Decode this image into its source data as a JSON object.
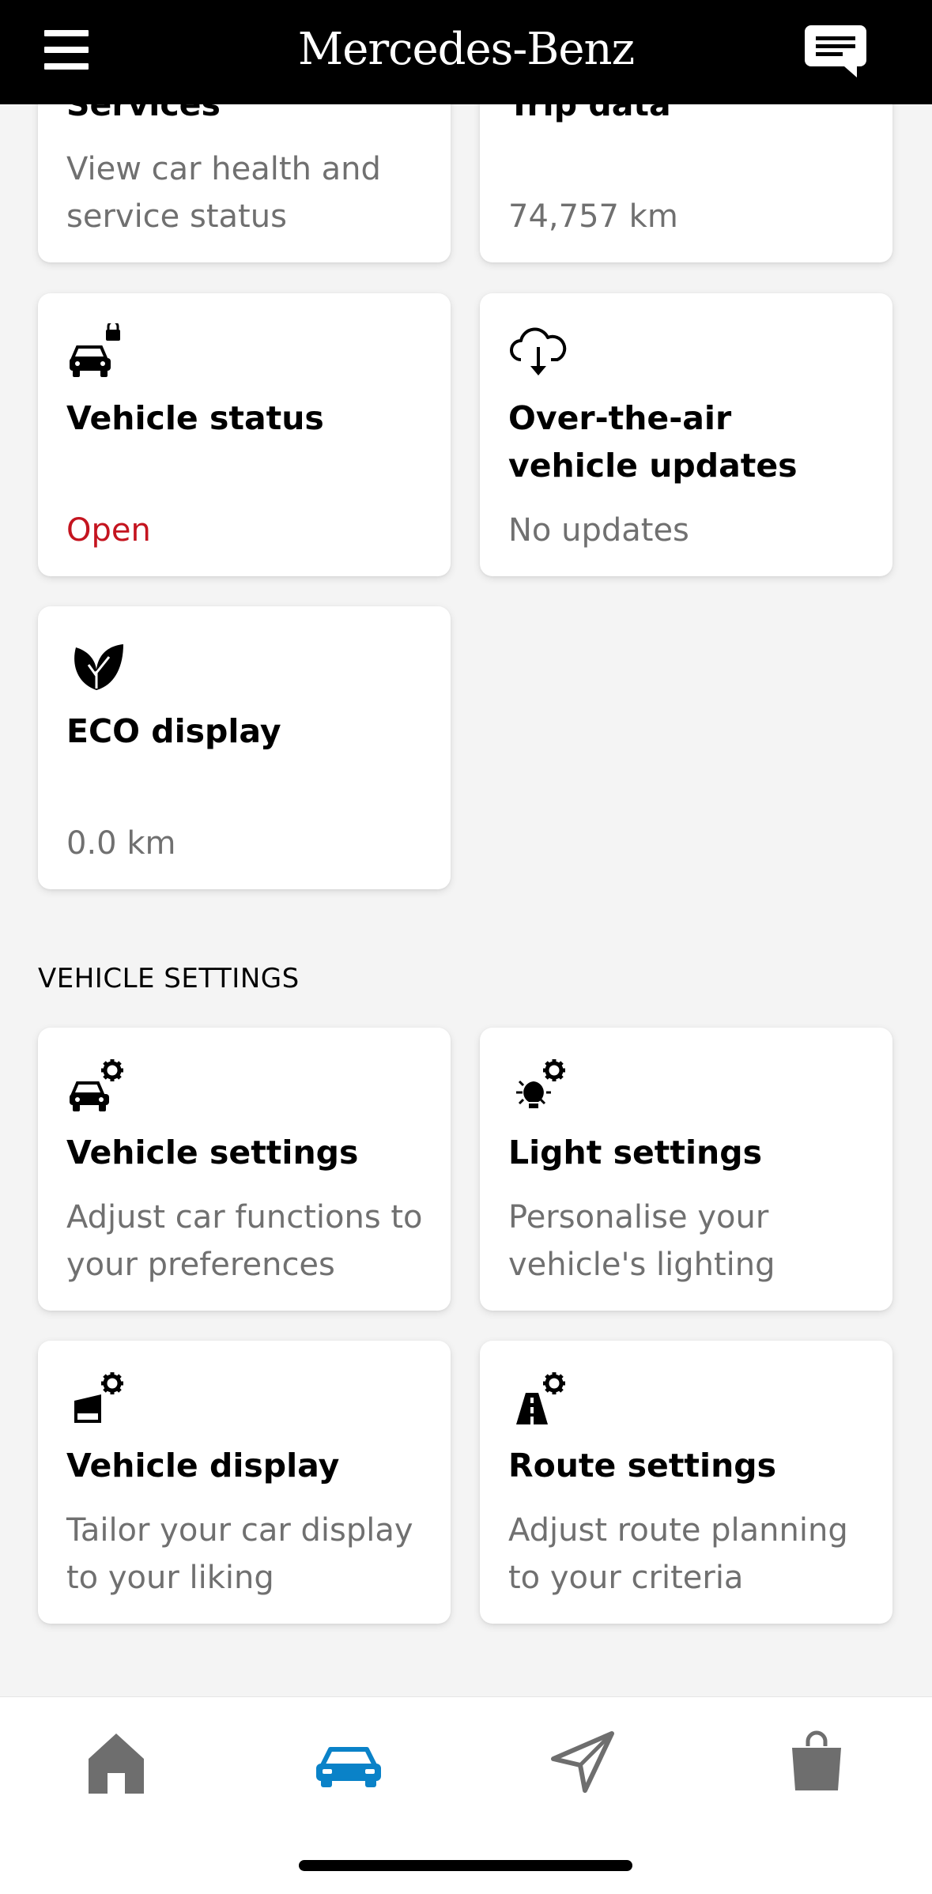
{
  "header": {
    "brand": "Mercedes-Benz",
    "menu_icon": "hamburger-menu-icon",
    "chat_icon": "chat-bubble-icon",
    "background": "#000000"
  },
  "cards_top": [
    {
      "title": "Services",
      "subtitle": "View car health and service status"
    },
    {
      "title": "Trip data",
      "subtitle": "74,757 km"
    },
    {
      "title": "Vehicle status",
      "subtitle": "Open",
      "icon": "car-lock-icon",
      "subtitle_color": "#c4141f"
    },
    {
      "title": "Over-the-air vehicle updates",
      "subtitle": "No updates",
      "icon": "cloud-download-icon"
    },
    {
      "title": "ECO display",
      "subtitle": "0.0 km",
      "icon": "leaf-icon"
    }
  ],
  "vehicle_settings": {
    "section_title": "VEHICLE SETTINGS",
    "cards": [
      {
        "title": "Vehicle settings",
        "subtitle": "Adjust car functions to your preferences",
        "icon": "car-gear-icon"
      },
      {
        "title": "Light settings",
        "subtitle": "Personalise your vehicle's lighting",
        "icon": "light-gear-icon"
      },
      {
        "title": "Vehicle display",
        "subtitle": "Tailor your car display to your liking",
        "icon": "display-gear-icon"
      },
      {
        "title": "Route settings",
        "subtitle": "Adjust route planning to your criteria",
        "icon": "road-gear-icon"
      }
    ]
  },
  "bottom_nav": {
    "items": [
      {
        "icon": "home-icon",
        "active": false
      },
      {
        "icon": "car-icon",
        "active": true
      },
      {
        "icon": "navigation-arrow-icon",
        "active": false
      },
      {
        "icon": "shopping-bag-icon",
        "active": false
      }
    ],
    "active_color": "#0a82c8",
    "inactive_color": "#6e6e6e"
  }
}
